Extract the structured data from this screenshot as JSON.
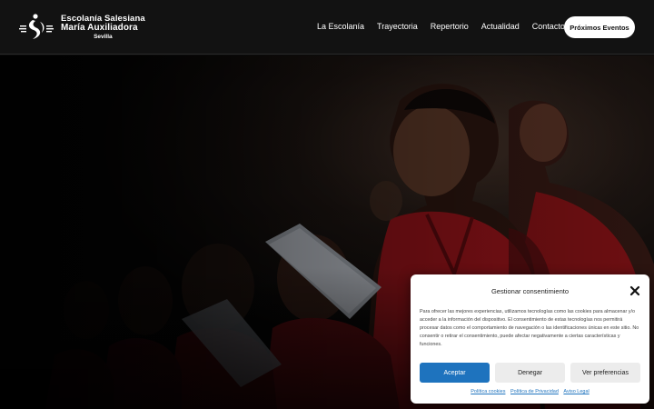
{
  "brand": {
    "line1": "Escolanía Salesiana",
    "line2": "María Auxiliadora",
    "line3": "Sevilla"
  },
  "nav": {
    "items": [
      {
        "label": "La Escolanía"
      },
      {
        "label": "Trayectoria"
      },
      {
        "label": "Repertorio"
      },
      {
        "label": "Actualidad"
      },
      {
        "label": "Contacto"
      }
    ],
    "cta_label": "Próximos Eventos"
  },
  "colors": {
    "header_bg": "#121212",
    "accent_blue": "#1e73be",
    "robe_red": "#7a0f14"
  },
  "cookie": {
    "title": "Gestionar consentimiento",
    "body": "Para ofrecer las mejores experiencias, utilizamos tecnologías como las cookies para almacenar y/o acceder a la información del dispositivo. El consentimiento de estas tecnologías nos permitirá procesar datos como el comportamiento de navegación o las identificaciones únicas en este sitio. No consentir o retirar el consentimiento, puede afectar negativamente a ciertas características y funciones.",
    "accept_label": "Aceptar",
    "deny_label": "Denegar",
    "prefs_label": "Ver preferencias",
    "links": [
      {
        "label": "Política cookies"
      },
      {
        "label": "Política de Privacidad"
      },
      {
        "label": "Aviso Legal"
      }
    ],
    "close_icon": "close-icon"
  }
}
